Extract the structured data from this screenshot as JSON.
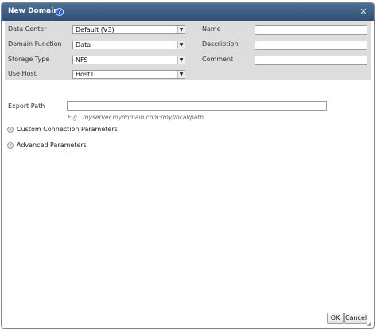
{
  "dialog": {
    "title": "New Domain"
  },
  "fields": {
    "data_center": {
      "label": "Data Center",
      "value": "Default (V3)"
    },
    "domain_function": {
      "label": "Domain Function",
      "value": "Data"
    },
    "storage_type": {
      "label": "Storage Type",
      "value": "NFS"
    },
    "use_host": {
      "label": "Use Host",
      "value": "Host1"
    },
    "name": {
      "label": "Name",
      "value": ""
    },
    "description": {
      "label": "Description",
      "value": ""
    },
    "comment": {
      "label": "Comment",
      "value": ""
    },
    "export_path": {
      "label": "Export Path",
      "value": "",
      "hint": "E.g.: myserver.mydomain.com:/my/local/path"
    }
  },
  "sections": {
    "custom_connection": "Custom Connection Parameters",
    "advanced": "Advanced Parameters"
  },
  "buttons": {
    "ok": "OK",
    "cancel": "Cancel"
  },
  "colors": {
    "title_bar": "#3d5d82",
    "panel": "#dddddd"
  },
  "icons": [
    "help-icon",
    "close-icon",
    "dropdown-arrow-icon",
    "chevron-right-icon",
    "resize-grip-icon"
  ]
}
